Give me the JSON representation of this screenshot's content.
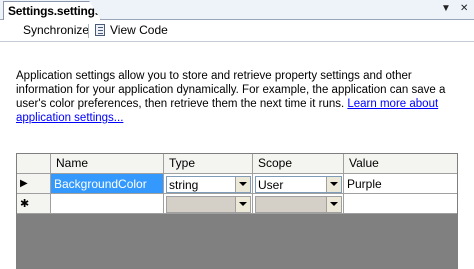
{
  "tab": {
    "title": "Settings.settings",
    "dropdown_glyph": "▼",
    "close_glyph": "✕"
  },
  "toolbar": {
    "synchronize_label": "Synchronize",
    "view_code_label": "View Code"
  },
  "description": {
    "text": "Application settings allow you to store and retrieve property settings and other information for your application dynamically. For example, the application can save a user's color preferences, then retrieve them the next time it runs. ",
    "link_text": "Learn more about application settings..."
  },
  "grid": {
    "columns": [
      "Name",
      "Type",
      "Scope",
      "Value"
    ],
    "rows": [
      {
        "marker": "▶",
        "name": "BackgroundColor",
        "type": "string",
        "scope": "User",
        "value": "Purple"
      },
      {
        "marker": "✱",
        "name": "",
        "type": "",
        "scope": "",
        "value": ""
      }
    ]
  },
  "colors": {
    "selection": "#3399ff",
    "link": "#0000ff",
    "tab_strip": "#eef3fa",
    "grid_background": "#808080"
  }
}
